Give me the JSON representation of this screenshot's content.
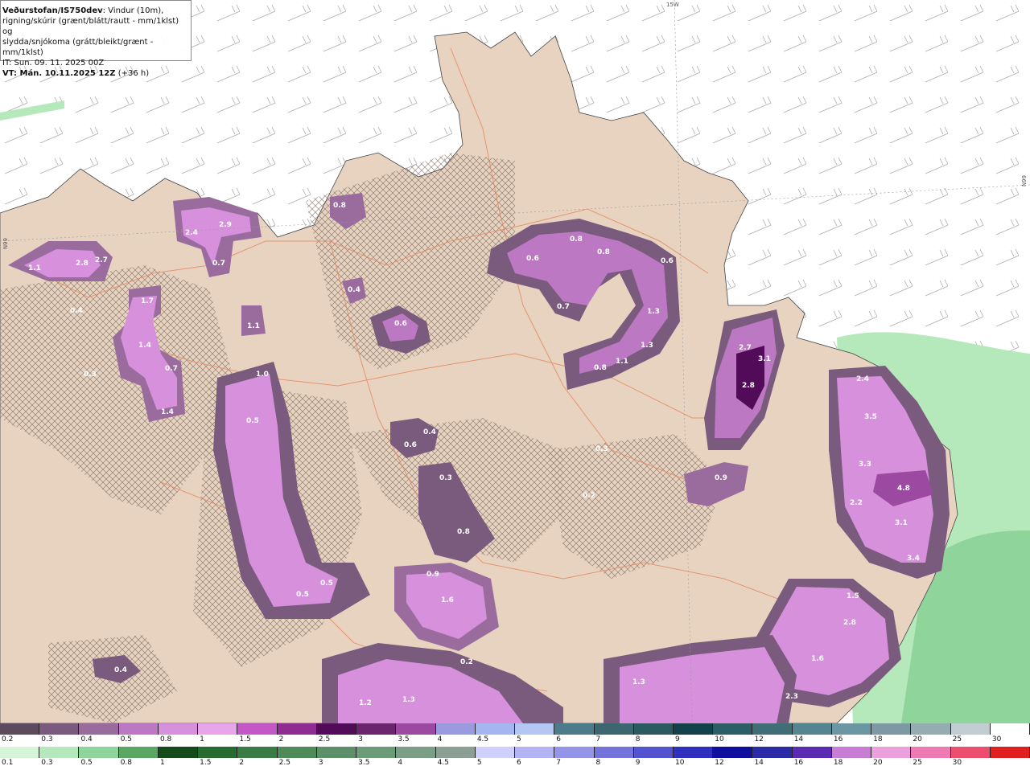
{
  "header": {
    "brand": "Veðurstofan/IS750dev",
    "desc_1": ": Vindur (10m),",
    "desc_2": "rigning/skúrir (grænt/blátt/rautt - mm/1klst) og",
    "desc_3": "slydda/snjókoma (grátt/bleikt/grænt - mm/1klst)",
    "it_line": "IT: Sun. 09. 11. 2025 00Z",
    "vt_bold": "VT: Mán. 10.11.2025 12Z",
    "vt_rest": " (+36 h)"
  },
  "meridians": {
    "top": "15W",
    "right": "66N",
    "left": "66N"
  },
  "map_values": [
    "1.1",
    "2.8",
    "2.7",
    "2.4",
    "2.9",
    "0.7",
    "0.8",
    "0.4",
    "1.7",
    "1.4",
    "0.7",
    "1.4",
    "0.3",
    "0.4",
    "1.1",
    "0.6",
    "0.8",
    "0.6",
    "0.8",
    "0.6",
    "0.7",
    "1.3",
    "1.3",
    "0.8",
    "1.1",
    "2.7",
    "3.1",
    "2.8",
    "2.4",
    "3.5",
    "3.3",
    "4.8",
    "2.2",
    "3.1",
    "3.4",
    "1.5",
    "2.8",
    "1.6",
    "2.3",
    "1.3",
    "1.2",
    "1.3",
    "0.4",
    "0.9",
    "1.6",
    "0.5",
    "0.3",
    "0.8",
    "1.0",
    "0.5",
    "0.5",
    "0.2",
    "0.6",
    "0.4",
    "0.9",
    "0.3",
    "0.2"
  ],
  "legend_snow": {
    "colors": [
      "#5e4a5f",
      "#7a5a7d",
      "#9a6c9e",
      "#bd78c3",
      "#d690dc",
      "#e7a6ea",
      "#c357c8",
      "#8e2c93",
      "#520b58",
      "#6b256f",
      "#9c4aa1",
      "#9a9adf",
      "#a4b5f0",
      "#b4c7f4",
      "#4c7c8b",
      "#3c6670",
      "#2b5a60",
      "#13434a",
      "#2c5e66",
      "#3f6e77",
      "#548591",
      "#6a97a2",
      "#7d9aa4",
      "#95acb3",
      "#c2cdd2",
      "#ffffff"
    ],
    "labels": [
      "0.2",
      "0.3",
      "0.4",
      "0.5",
      "0.8",
      "1",
      "1.5",
      "2",
      "2.5",
      "3",
      "3.5",
      "4",
      "4.5",
      "5",
      "6",
      "7",
      "8",
      "9",
      "10",
      "12",
      "14",
      "16",
      "18",
      "20",
      "25",
      "30"
    ]
  },
  "legend_rain": {
    "colors": [
      "#d5f5d9",
      "#b5e8bb",
      "#8fd49a",
      "#5aa764",
      "#154b1a",
      "#276b2f",
      "#3b7c45",
      "#4e8b58",
      "#5d9068",
      "#6c9b77",
      "#7b9f86",
      "#8b9f95",
      "#d0d0ff",
      "#b4b4f5",
      "#9494e8",
      "#7373db",
      "#5353cf",
      "#3030bf",
      "#10109e",
      "#2a2aa6",
      "#5a2ab2",
      "#c87dd5",
      "#eaa0dd",
      "#ee7ab4",
      "#eb4f6d",
      "#e02020"
    ],
    "labels": [
      "0.1",
      "0.3",
      "0.5",
      "0.8",
      "1",
      "1.5",
      "2",
      "2.5",
      "3",
      "3.5",
      "4",
      "4.5",
      "5",
      "6",
      "7",
      "8",
      "9",
      "10",
      "12",
      "14",
      "16",
      "18",
      "20",
      "25",
      "30",
      ""
    ]
  }
}
